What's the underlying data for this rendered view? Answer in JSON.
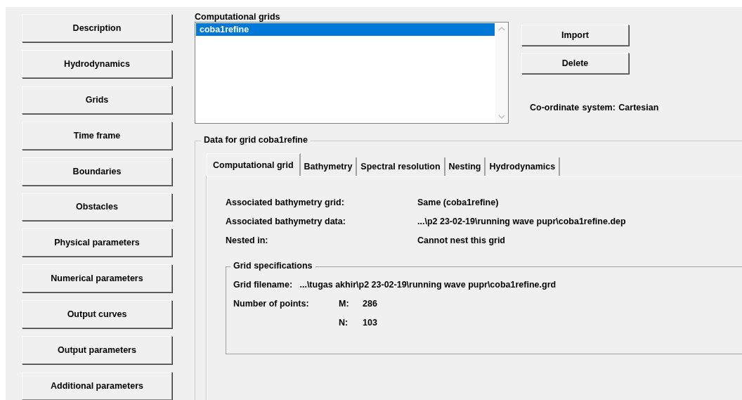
{
  "nav_buttons": [
    "Description",
    "Hydrodynamics",
    "Grids",
    "Time frame",
    "Boundaries",
    "Obstacles",
    "Physical parameters",
    "Numerical parameters",
    "Output curves",
    "Output parameters",
    "Additional parameters"
  ],
  "computational_grids": {
    "label": "Computational grids",
    "items": [
      {
        "name": "coba1refine",
        "selected": true
      }
    ]
  },
  "buttons": [
    "Import",
    "Delete"
  ],
  "coordinate_system": {
    "label": "Co-ordinate system:",
    "value": "Cartesian"
  },
  "grid_data": {
    "title": "Data for grid coba1refine",
    "tabs": [
      {
        "label": "Computational grid",
        "selected": true
      },
      {
        "label": "Bathymetry",
        "selected": false
      },
      {
        "label": "Spectral resolution",
        "selected": false
      },
      {
        "label": "Nesting",
        "selected": false
      },
      {
        "label": "Hydrodynamics",
        "selected": false
      }
    ],
    "properties": [
      {
        "label": "Associated bathymetry grid:",
        "value": "Same (coba1refine)"
      },
      {
        "label": "Associated bathymetry data:",
        "value": "...\\p2 23-02-19\\running wave pupr\\coba1refine.dep"
      },
      {
        "label": "Nested in:",
        "value": "Cannot nest this grid"
      }
    ],
    "grid_specifications": {
      "title": "Grid specifications",
      "filename_label": "Grid filename:",
      "filename": "...\\tugas akhir\\p2 23-02-19\\running wave pupr\\coba1refine.grd",
      "points_label": "Number of points:",
      "m_label": "M:",
      "m": "286",
      "n_label": "N:",
      "n": "103"
    }
  }
}
